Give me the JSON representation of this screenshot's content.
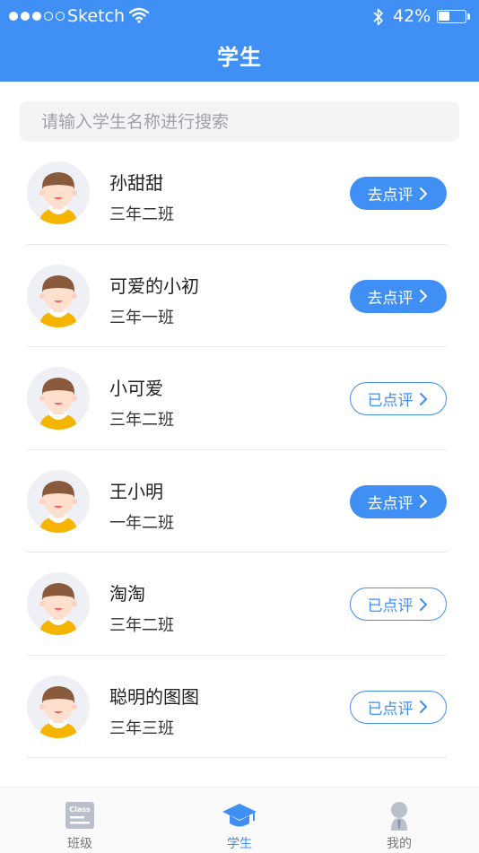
{
  "status_bar": {
    "carrier": "Sketch",
    "battery_percent": "42%",
    "battery_level": 0.42
  },
  "header": {
    "title": "学生"
  },
  "search": {
    "placeholder": "请输入学生名称进行搜索"
  },
  "students": [
    {
      "name": "孙甜甜",
      "class": "三年二班",
      "action": "去点评",
      "state": "pending"
    },
    {
      "name": "可爱的小初",
      "class": "三年一班",
      "action": "去点评",
      "state": "pending"
    },
    {
      "name": "小可爱",
      "class": "三年二班",
      "action": "已点评",
      "state": "done"
    },
    {
      "name": "王小明",
      "class": "一年二班",
      "action": "去点评",
      "state": "pending"
    },
    {
      "name": "淘淘",
      "class": "三年二班",
      "action": "已点评",
      "state": "done"
    },
    {
      "name": "聪明的图图",
      "class": "三年三班",
      "action": "已点评",
      "state": "done"
    }
  ],
  "tabbar": {
    "tabs": [
      {
        "label": "班级",
        "icon": "class-icon",
        "icon_text": "Class",
        "active": false
      },
      {
        "label": "学生",
        "icon": "graduation-cap-icon",
        "active": true
      },
      {
        "label": "我的",
        "icon": "profile-icon",
        "active": false
      }
    ]
  },
  "colors": {
    "accent": "#3f8ff4",
    "avatar_bg": "#eef0f6",
    "hair": "#8a5a3c",
    "shirt": "#f5b400",
    "skin": "#ffe0cf"
  }
}
